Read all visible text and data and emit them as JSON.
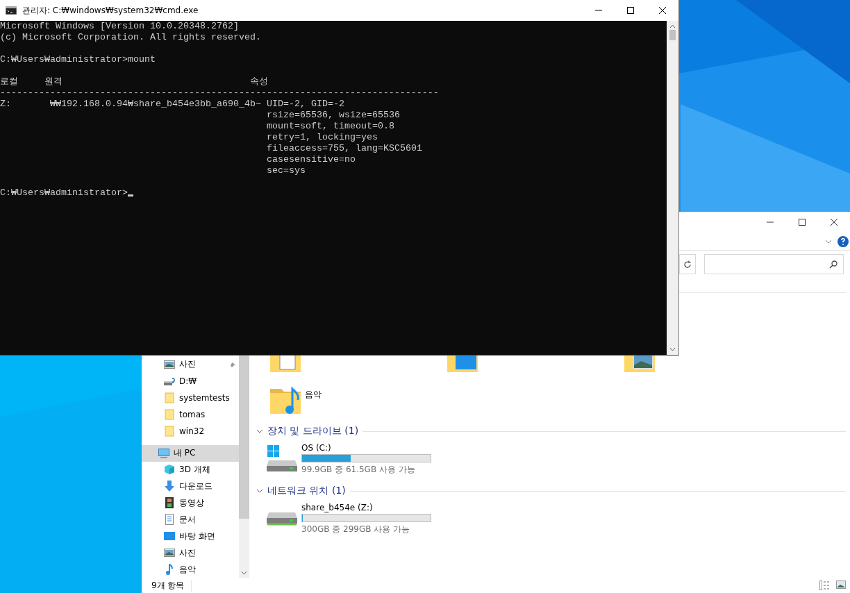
{
  "cmd_window": {
    "title": "관리자: C:₩windows₩system32₩cmd.exe",
    "lines": [
      {
        "kind": "text",
        "text": "Microsoft Windows [Version 10.0.20348.2762]"
      },
      {
        "kind": "text",
        "text": "(c) Microsoft Corporation. All rights reserved."
      },
      {
        "kind": "blank"
      },
      {
        "kind": "text",
        "text": "C:₩Users₩administrator>mount"
      },
      {
        "kind": "blank"
      },
      {
        "kind": "header",
        "local": "로컬",
        "remote": "원격",
        "attributes": "속성"
      },
      {
        "kind": "text",
        "text": "-------------------------------------------------------------------------------"
      },
      {
        "kind": "mount",
        "local": "Z:",
        "remote": "₩₩192.168.0.94₩share_b454e3bb_a690_4b~",
        "attributes": [
          "UID=-2, GID=-2",
          "rsize=65536, wsize=65536",
          "mount=soft, timeout=0.8",
          "retry=1, locking=yes",
          "fileaccess=755, lang=KSC5601",
          "casesensitive=no",
          "sec=sys"
        ]
      },
      {
        "kind": "blank"
      },
      {
        "kind": "prompt",
        "text": "C:₩Users₩administrator>"
      }
    ]
  },
  "explorer": {
    "nav_items": [
      {
        "label": "사진",
        "kind": "pictures",
        "pinned": true,
        "selected": false
      },
      {
        "label": "D:₩",
        "kind": "drive",
        "pinned": false,
        "selected": false
      },
      {
        "label": "systemtests",
        "kind": "folder",
        "pinned": false,
        "selected": false
      },
      {
        "label": "tomas",
        "kind": "folder",
        "pinned": false,
        "selected": false
      },
      {
        "label": "win32",
        "kind": "folder",
        "pinned": false,
        "selected": false
      },
      {
        "label": "내 PC",
        "kind": "pc",
        "pinned": false,
        "selected": true
      },
      {
        "label": "3D 개체",
        "kind": "objects",
        "pinned": false,
        "selected": false
      },
      {
        "label": "다운로드",
        "kind": "downloads",
        "pinned": false,
        "selected": false
      },
      {
        "label": "동영상",
        "kind": "videos",
        "pinned": false,
        "selected": false
      },
      {
        "label": "문서",
        "kind": "documents",
        "pinned": false,
        "selected": false
      },
      {
        "label": "바탕 화면",
        "kind": "desktop",
        "pinned": false,
        "selected": false
      },
      {
        "label": "사진",
        "kind": "pictures",
        "pinned": false,
        "selected": false
      },
      {
        "label": "음악",
        "kind": "music",
        "pinned": false,
        "selected": false
      }
    ],
    "folders": [
      {
        "kind": "documents"
      },
      {
        "kind": "desktop"
      },
      {
        "kind": "pictures"
      },
      {
        "kind": "music",
        "label": "음악"
      }
    ],
    "groups": [
      {
        "title": "장치 및 드라이브 (1)",
        "drives": [
          {
            "name": "OS (C:)",
            "kind": "local",
            "level": 0.38,
            "detail": "99.9GB 중 61.5GB 사용 가능"
          }
        ]
      },
      {
        "title": "네트워크 위치 (1)",
        "drives": [
          {
            "name": "share_b454e (Z:)",
            "kind": "network",
            "level": 0.003,
            "detail": "300GB 중 299GB 사용 가능"
          }
        ]
      }
    ],
    "status": "9개 항목"
  }
}
